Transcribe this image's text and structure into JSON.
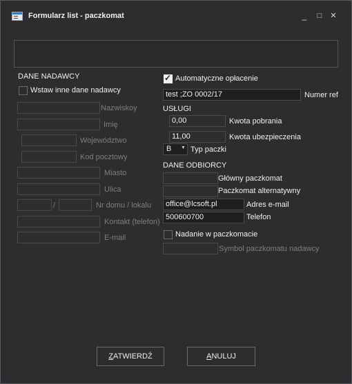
{
  "window": {
    "title": "Formularz list - paczkomat",
    "controls": {
      "minimize": "_",
      "maximize": "□",
      "close": "✕"
    }
  },
  "sender": {
    "heading": "DANE NADAWCY",
    "other_data_checkbox": "Wstaw inne dane nadawcy",
    "other_data_checked": false,
    "fields": {
      "surname": "Nazwiskoy",
      "name": "Imię",
      "voivodeship": "Województwo",
      "postal_code": "Kod pocztowy",
      "city": "Miasto",
      "street": "Ulica",
      "house_number": "Nr domu / lokalu",
      "number_separator": "/",
      "contact": "Kontakt (telefon)",
      "email": "E-mail"
    }
  },
  "payment": {
    "auto_payment_label": "Automatyczne opłacenie",
    "auto_payment_checked": true
  },
  "reference": {
    "value": "test ;ZO 0002/17",
    "label": "Numer ref"
  },
  "services": {
    "heading": "USŁUGI",
    "cod_value": "0,00",
    "cod_label": "Kwota pobrania",
    "insurance_value": "11,00",
    "insurance_label": "Kwota ubezpieczenia",
    "parcel_type_value": "B",
    "parcel_type_label": "Typ paczki"
  },
  "recipient": {
    "heading": "DANE ODBIORCY",
    "main_locker_label": "Główny paczkomat",
    "main_locker_value": "",
    "alt_locker_label": "Paczkomat alternatywny",
    "alt_locker_value": "",
    "email_value": "office@lcsoft.pl",
    "email_label": "Adres e-mail",
    "phone_value": "500600700",
    "phone_label": "Telefon"
  },
  "dispatch": {
    "locker_dispatch_label": "Nadanie w paczkomacie",
    "locker_dispatch_checked": false,
    "sender_locker_symbol_label": "Symbol paczkomatu nadawcy"
  },
  "buttons": {
    "confirm_pre": "",
    "confirm_u": "Z",
    "confirm_post": "ATWIERDŹ",
    "cancel_pre": "",
    "cancel_u": "A",
    "cancel_post": "NULUJ"
  }
}
